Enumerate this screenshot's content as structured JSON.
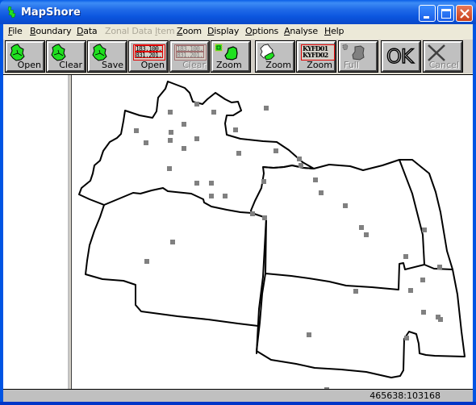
{
  "window": {
    "title": "MapShore",
    "controls": [
      "minimize",
      "maximize",
      "close"
    ]
  },
  "menu": [
    {
      "label": "File",
      "accel": "F",
      "enabled": true
    },
    {
      "label": "Boundary",
      "accel": "B",
      "enabled": true
    },
    {
      "label": "Data",
      "accel": "D",
      "enabled": true
    },
    {
      "label": "Zonal Data Item",
      "accel": "I",
      "enabled": false
    },
    {
      "label": "Zoom",
      "accel": "Z",
      "enabled": true
    },
    {
      "label": "Display",
      "accel": "D",
      "enabled": true
    },
    {
      "label": "Options",
      "accel": "O",
      "enabled": true
    },
    {
      "label": "Analyse",
      "accel": "A",
      "enabled": true
    },
    {
      "label": "Help",
      "accel": "H",
      "enabled": true
    }
  ],
  "toolbar": {
    "boundary_open": {
      "label": "Open",
      "icon": "boundary-map-icon",
      "enabled": true
    },
    "boundary_clear": {
      "label": "Clear",
      "icon": "boundary-map-icon",
      "enabled": true
    },
    "boundary_save": {
      "label": "Save",
      "icon": "boundary-map-icon",
      "enabled": true
    },
    "data_open": {
      "label": "Open",
      "icon": "data-grid-icon",
      "enabled": true,
      "line1": "183,100,8",
      "line2": "831,201,5"
    },
    "data_clear": {
      "label": "Clear",
      "icon": "data-grid-icon",
      "enabled": false,
      "line1": "183,100,8",
      "line2": "831,201,5"
    },
    "zoom_region": {
      "label": "Zoom",
      "icon": "zoom-region-icon",
      "enabled": true
    },
    "zoom_zone": {
      "label": "Zoom",
      "icon": "zoom-zone-icon",
      "enabled": true
    },
    "zoom_code": {
      "label": "Zoom",
      "icon": "zoom-code-icon",
      "enabled": true,
      "line1": "KYFD01",
      "line2": "KYFD02"
    },
    "full": {
      "label": "Full",
      "icon": "full-extent-icon",
      "enabled": false
    },
    "ok": {
      "label": "OK",
      "enabled": true
    },
    "cancel": {
      "label": "Cancel",
      "icon": "cancel-x-icon",
      "enabled": false
    }
  },
  "map": {
    "boundary_color": "#000000",
    "point_color": "#808080",
    "zone_count": 5,
    "point_count": 43
  },
  "status": {
    "coordinates": "465638:103168"
  }
}
